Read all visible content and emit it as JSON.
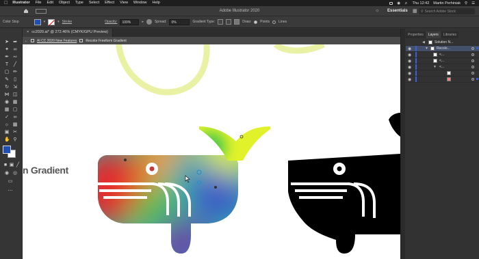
{
  "menubar": {
    "app": "Illustrator",
    "items": [
      "File",
      "Edit",
      "Object",
      "Type",
      "Select",
      "Effect",
      "View",
      "Window",
      "Help"
    ],
    "clock": "Thu 12:42",
    "user": "Martin Perhiniak"
  },
  "appbar": {
    "title": "Adobe Illustrator 2020",
    "workspace": "Essentials",
    "search_placeholder": "Search Adobe Stock"
  },
  "control": {
    "context_label": "Color Stop",
    "stroke_label": "Stroke",
    "opacity_label": "Opacity:",
    "opacity_value": "100%",
    "spread_label": "Spread:",
    "spread_value": "0%",
    "gradient_type_label": "Gradient Type:",
    "draw_label": "Draw:",
    "draw_options": [
      "Points",
      "Lines"
    ]
  },
  "document": {
    "tab_title": "cc2020.ai* @ 272.46% (CMYK/GPU Preview)",
    "close_glyph": "×",
    "breadcrumb": [
      "AI CC 2020 New Features",
      "Recolor Freeform Gradient"
    ]
  },
  "canvas": {
    "headline_fragment": "n Gradient",
    "colors": {
      "gradient_red": "#e8262a",
      "gradient_orange": "#f59a1f",
      "gradient_yellow": "#e2f22a",
      "gradient_green": "#3fc64b",
      "gradient_teal": "#2fb8a9",
      "gradient_blue": "#3a57c9",
      "gradient_purple": "#6b3fa8",
      "loop_stroke": "#e9f2a4",
      "whale_black": "#000000"
    }
  },
  "panels": {
    "tabs": [
      "Properties",
      "Layers",
      "Libraries"
    ],
    "active_tab": "Layers",
    "layers": [
      {
        "name": "Solution N...",
        "selected": false
      },
      {
        "name": "Recolo...",
        "selected": true
      },
      {
        "name": "<...",
        "selected": false
      },
      {
        "name": "<...",
        "selected": false
      },
      {
        "name": "<...",
        "selected": false
      },
      {
        "name": "",
        "selected": false
      },
      {
        "name": "",
        "selected": false
      }
    ]
  },
  "tools": {
    "fill_color": "#1f4fb4",
    "stroke_color": "#ffffff"
  }
}
